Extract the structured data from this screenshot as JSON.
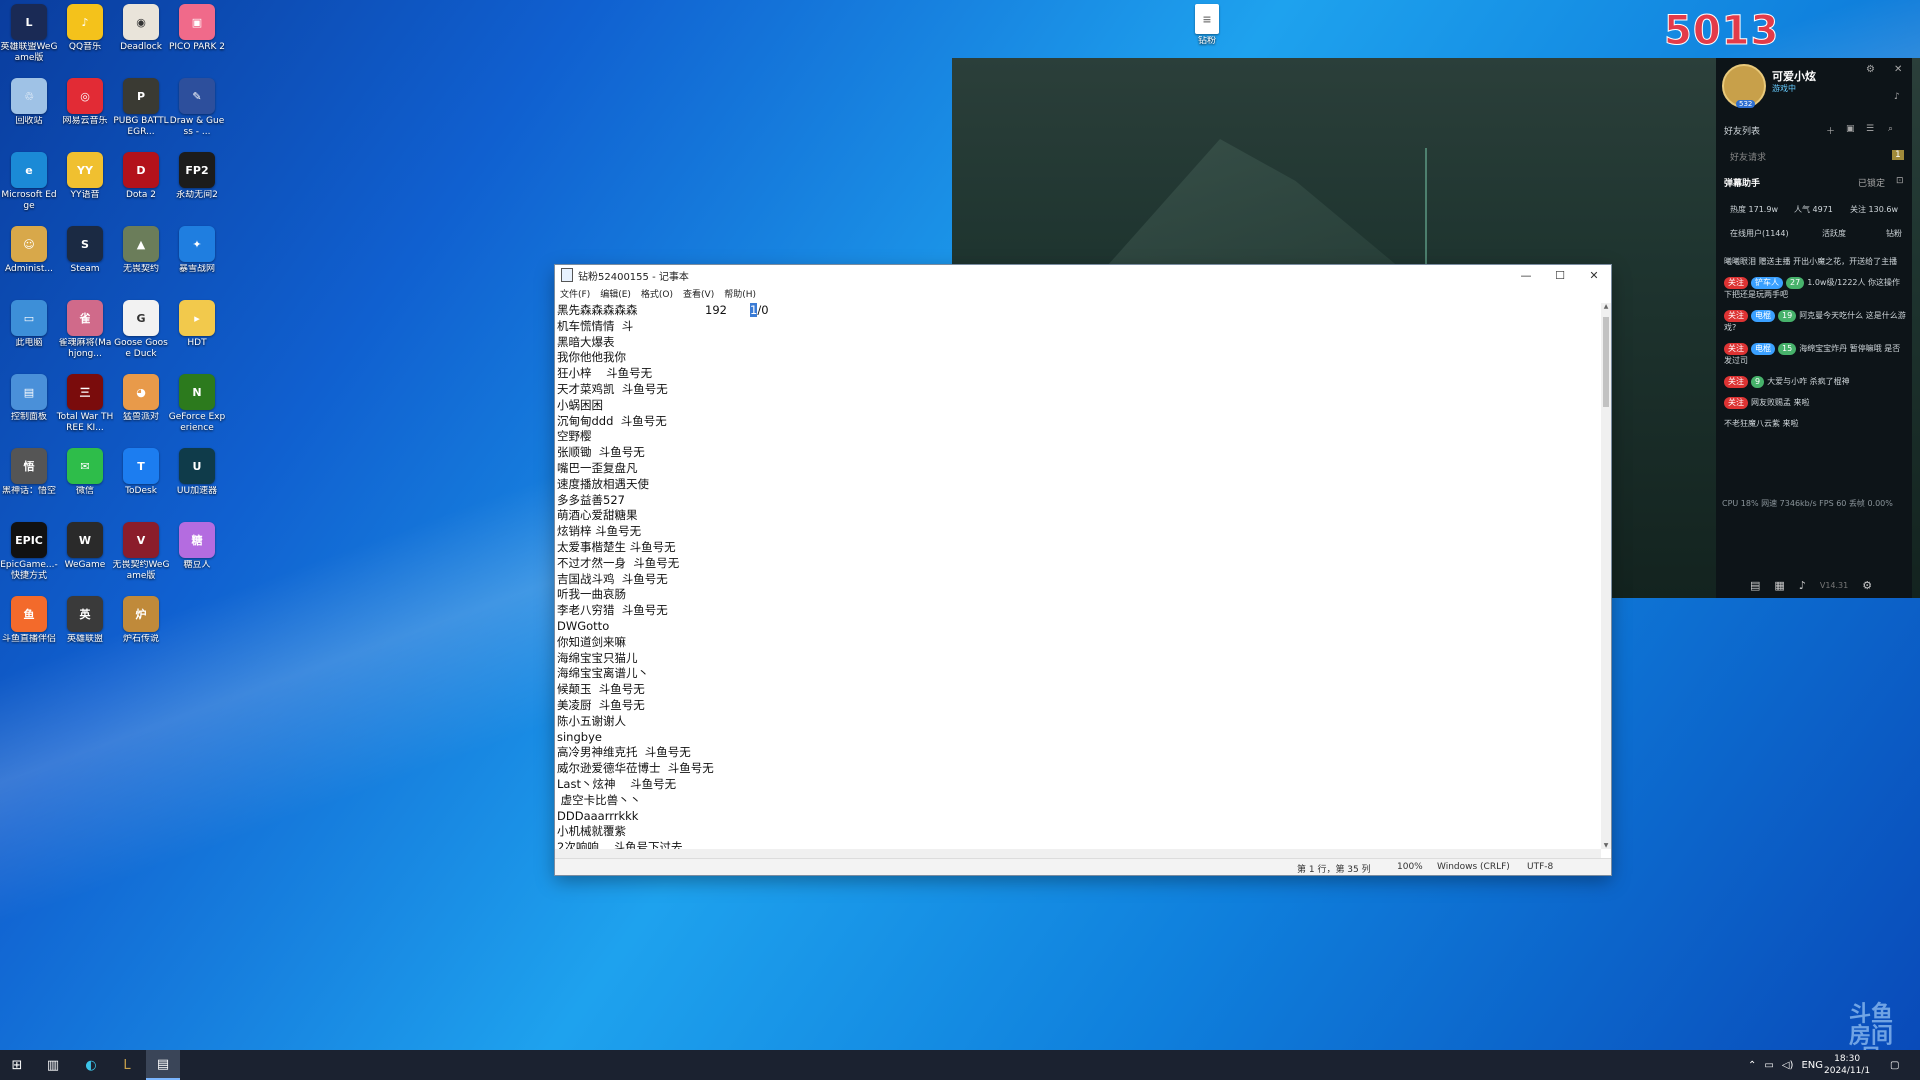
{
  "desktop": {
    "icons": [
      {
        "label": "英雄联盟WeGame版",
        "icon": "lol-icon",
        "color": "#1a2a55",
        "glyph": "L"
      },
      {
        "label": "QQ音乐",
        "icon": "qqmusic-icon",
        "color": "#f4c21b",
        "glyph": "♪"
      },
      {
        "label": "Deadlock",
        "icon": "deadlock-icon",
        "color": "#e9e4da",
        "glyph": "◉"
      },
      {
        "label": "PICO PARK 2",
        "icon": "picopark-icon",
        "color": "#f06a8a",
        "glyph": "▣"
      },
      {
        "label": "回收站",
        "icon": "recycle-bin-icon",
        "color": "#9fc2e6",
        "glyph": "♲"
      },
      {
        "label": "网易云音乐",
        "icon": "netease-music-icon",
        "color": "#e22b35",
        "glyph": "◎"
      },
      {
        "label": "PUBG BATTLEGR...",
        "icon": "pubg-icon",
        "color": "#3a3a33",
        "glyph": "P"
      },
      {
        "label": "Draw & Guess - ...",
        "icon": "draw-guess-icon",
        "color": "#2d4f9c",
        "glyph": "✎"
      },
      {
        "label": "Microsoft Edge",
        "icon": "edge-icon",
        "color": "#1b8ad6",
        "glyph": "e"
      },
      {
        "label": "YY语音",
        "icon": "yy-icon",
        "color": "#f0c030",
        "glyph": "YY"
      },
      {
        "label": "Dota 2",
        "icon": "dota2-icon",
        "color": "#b3121b",
        "glyph": "D"
      },
      {
        "label": "永劫无间2",
        "icon": "fp2-icon",
        "color": "#1c1c1c",
        "glyph": "FP2"
      },
      {
        "label": "Administ...",
        "icon": "user-folder-icon",
        "color": "#d8a84a",
        "glyph": "☺"
      },
      {
        "label": "Steam",
        "icon": "steam-icon",
        "color": "#1b2a43",
        "glyph": "S"
      },
      {
        "label": "无畏契约",
        "icon": "game-icon",
        "color": "#6b7d5a",
        "glyph": "▲"
      },
      {
        "label": "暴雪战网",
        "icon": "battlenet-icon",
        "color": "#1f7ee0",
        "glyph": "✦"
      },
      {
        "label": "此电脑",
        "icon": "this-pc-icon",
        "color": "#3d8fd8",
        "glyph": "▭"
      },
      {
        "label": "雀魂麻将(Mahjong...",
        "icon": "mahjong-icon",
        "color": "#d06a8a",
        "glyph": "雀"
      },
      {
        "label": "Goose Goose Duck",
        "icon": "goose-icon",
        "color": "#f2f2f2",
        "glyph": "G"
      },
      {
        "label": "HDT",
        "icon": "folder-icon",
        "color": "#f2c94c",
        "glyph": "▸"
      },
      {
        "label": "控制面板",
        "icon": "control-panel-icon",
        "color": "#4a90d9",
        "glyph": "▤"
      },
      {
        "label": "Total War THREE KI...",
        "icon": "totalwar-icon",
        "color": "#7a0c0c",
        "glyph": "三"
      },
      {
        "label": "猛兽派对",
        "icon": "party-animals-icon",
        "color": "#e89a4a",
        "glyph": "◕"
      },
      {
        "label": "GeForce Experience",
        "icon": "nvidia-icon",
        "color": "#2c7a1d",
        "glyph": "N"
      },
      {
        "label": "黑神话：悟空",
        "icon": "wukong-icon",
        "color": "#555",
        "glyph": "悟"
      },
      {
        "label": "微信",
        "icon": "wechat-icon",
        "color": "#2ebd4a",
        "glyph": "✉"
      },
      {
        "label": "ToDesk",
        "icon": "todesk-icon",
        "color": "#1c7df0",
        "glyph": "T"
      },
      {
        "label": "UU加速器",
        "icon": "uu-icon",
        "color": "#0f3b4a",
        "glyph": "U"
      },
      {
        "label": "EpicGame...- 快捷方式",
        "icon": "epic-icon",
        "color": "#111",
        "glyph": "EPIC"
      },
      {
        "label": "WeGame",
        "icon": "wegame-icon",
        "color": "#2a2a2a",
        "glyph": "W"
      },
      {
        "label": "无畏契约WeGame版",
        "icon": "valorant-icon",
        "color": "#8b1d2b",
        "glyph": "V"
      },
      {
        "label": "糖豆人",
        "icon": "fallguys-icon",
        "color": "#b46ce0",
        "glyph": "糖"
      },
      {
        "label": "斗鱼直播伴侣",
        "icon": "douyu-icon",
        "color": "#f36a2b",
        "glyph": "鱼"
      },
      {
        "label": "英雄联盟",
        "icon": "lol2-icon",
        "color": "#3a3a3a",
        "glyph": "英"
      },
      {
        "label": "炉石传说",
        "icon": "hearthstone-icon",
        "color": "#c08a3a",
        "glyph": "炉"
      }
    ],
    "file_icon": {
      "label": "钻粉",
      "icon": "text-file-icon"
    },
    "counter": "5013",
    "watermark": "斗鱼 房间号"
  },
  "douyu": {
    "user_name": "可爱小炫",
    "status": "游戏中",
    "level": "532",
    "friends_list": "好友列表",
    "friend_request": "好友请求",
    "friend_request_count": "1",
    "bullet_helper": "弹幕助手",
    "locked": "已锁定",
    "heat": "热度 171.9w",
    "popularity": "人气 4971",
    "follow": "关注 130.6w",
    "tabs": [
      "在线用户(1144)",
      "活跃度",
      "钻粉"
    ],
    "chat": [
      {
        "text": "曦曦眼泪 赠送主播 开出小魔之花，开送给了主播"
      },
      {
        "tag": "关注",
        "lvl": "铲车人",
        "g": "27",
        "text": "1.0w级/1222人 你这操作下把还是玩两手吧"
      },
      {
        "tag": "关注",
        "lvl": "电棍",
        "g": "19",
        "text": "阿克曼今天吃什么 这是什么游戏?"
      },
      {
        "tag": "关注",
        "lvl": "电棍",
        "g": "15",
        "text": "海绵宝宝炸丹 暂停嘛哦 是否发过司"
      },
      {
        "tag": "关注",
        "lvl": "",
        "g": "9",
        "text": "大爱与小咋 杀疯了棍神"
      },
      {
        "tag": "关注",
        "lvl": "",
        "g": "",
        "text": "网友败赐孟 来啦"
      },
      {
        "tag": "",
        "lvl": "",
        "g": "",
        "text": "不老狂魔八云紫 来啦"
      }
    ],
    "perf": "CPU 18% 网速 7346kb/s FPS 60 丢帧 0.00%",
    "version": "V14.31"
  },
  "notepad": {
    "title": "钻粉52400155 - 记事本",
    "menu": [
      "文件(F)",
      "编辑(E)",
      "格式(O)",
      "查看(V)",
      "帮助(H)"
    ],
    "first_line": {
      "name": "黑先森森森森森",
      "num": "192",
      "sel": "1",
      "rest": "/0"
    },
    "lines": [
      "机车慌情情  斗",
      "黑暗大爆表",
      "我你他他我你",
      "狂小梓    斗鱼号无",
      "天才菜鸡凯  斗鱼号无",
      "小蜗困困",
      "沉甸甸ddd  斗鱼号无",
      "空野樱",
      "张顺锄  斗鱼号无",
      "嘴巴一歪复盘凡",
      "速度播放相遇天使",
      "多多益善527",
      "萌酒心爱甜糖果",
      "炫销梓 斗鱼号无",
      "太爱事楷楚生 斗鱼号无",
      "不过才然一身  斗鱼号无",
      "吉国战斗鸡  斗鱼号无",
      "听我一曲哀肠",
      "李老八穷猎  斗鱼号无",
      "DWGotto",
      "你知道剑来嘛",
      "海绵宝宝只猫儿",
      "海绵宝宝离谱儿丶",
      "候颠玉  斗鱼号无",
      "美凌厨  斗鱼号无",
      "陈小五谢谢人",
      "singbye",
      "高冷男神维克托  斗鱼号无",
      "威尔逊爱德华莅博士  斗鱼号无",
      "Last丶炫神    斗鱼号无",
      " 虚空卡比兽丶丶",
      "DDDaaarrrkkk",
      "小机械就覆紫",
      "2次响响    斗鱼号下过去"
    ],
    "status": {
      "pos": "第 1 行，第 35 列",
      "zoom": "100%",
      "eol": "Windows (CRLF)",
      "enc": "UTF-8"
    }
  },
  "taskbar": {
    "tray_lang": "ENG",
    "time": "18:30",
    "date": "2024/11/1"
  }
}
